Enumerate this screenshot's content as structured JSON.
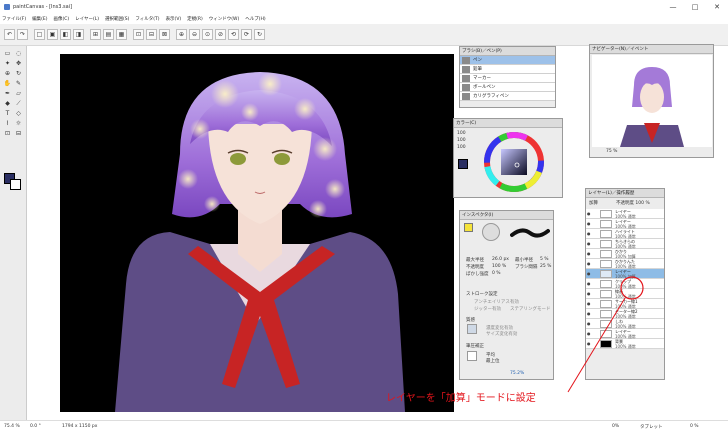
{
  "window": {
    "title": "paintCanvas - [Ins3.sai]",
    "controls": [
      "—",
      "□",
      "✕"
    ]
  },
  "menu": [
    "ファイル(F)",
    "編集(E)",
    "画像(C)",
    "レイヤー(L)",
    "選択範囲(S)",
    "フィルタ(T)",
    "表示(V)",
    "定規(R)",
    "ウィンドウ(W)",
    "ヘルプ(H)"
  ],
  "toolbar": {
    "buttons": [
      "↶",
      "↷",
      "□",
      "▣",
      "◧",
      "◨",
      "⊞",
      "▤",
      "▦",
      "⊡",
      "⊟",
      "⊠",
      "⊕",
      "⊖",
      "⊙",
      "⊘",
      "⟲",
      "⟳",
      "↻"
    ]
  },
  "brush_panel": {
    "tabs": "ブラシ(B)／ペン(P)",
    "items": [
      "ペン",
      "鉛筆",
      "マーカー",
      "ボールペン",
      "カリグラフィペン"
    ],
    "selected": 0
  },
  "color_panel": {
    "title": "カラー(C)",
    "values": [
      "100",
      "100",
      "100"
    ]
  },
  "inspector": {
    "title": "インスペクタ(I)",
    "brush_size_label": "最大半径",
    "brush_size": "26.0 px",
    "min_size_label": "最小半径",
    "min_size": "5 %",
    "density_label": "不透明度",
    "density": "100 %",
    "spacing_label": "ブラシ間隔",
    "spacing": "25 %",
    "blur_label": "ぼかし強度",
    "blur": "0 %",
    "stroke_title": "ストローク設定",
    "stroke_opt1": "アンチエイリアス有効",
    "stroke_opt2": "ジッター有効",
    "stroke_opt3": "ステアリングモード",
    "texture_title": "質感",
    "texture_opt1": "濃度変化有効",
    "texture_opt2": "サイズ変化有効",
    "pressure_title": "筆圧補正",
    "pressure_opt1": "平均",
    "pressure_opt2": "最上位",
    "zoom": "75.2%"
  },
  "navigator": {
    "title": "ナビゲーター(N)／イベント",
    "zoom": "75 %"
  },
  "layer_panel": {
    "title": "レイヤー(L)／操作履歴",
    "mode_label": "加算",
    "opacity_label": "不透明度 100 %",
    "layers": [
      {
        "name": "レイヤー",
        "mode": "100% 通常"
      },
      {
        "name": "レイヤー",
        "mode": "100% 通常"
      },
      {
        "name": "ハイライト",
        "mode": "100% 通常"
      },
      {
        "name": "ちらきらの",
        "mode": "100% 通常"
      },
      {
        "name": "ひかり",
        "mode": "100% 加算"
      },
      {
        "name": "ひかりんた",
        "mode": "100% 通常"
      },
      {
        "name": "レイヤー",
        "mode": "100% 加算"
      },
      {
        "name": "クリップ",
        "mode": "100% 通常"
      },
      {
        "name": "線画",
        "mode": "100% 通常"
      },
      {
        "name": "サーカー線1",
        "mode": "100% 通常"
      },
      {
        "name": "セーター線2",
        "mode": "100% 通常"
      },
      {
        "name": "しわ",
        "mode": "100% 通常"
      },
      {
        "name": "レイヤー",
        "mode": "100% 通常"
      },
      {
        "name": "背景",
        "mode": "100% 通常"
      }
    ],
    "selected": 6
  },
  "status": {
    "zoom": "75.4 %",
    "angle": "0.0 °",
    "size": "1794 x 1150 px",
    "right1": "0%",
    "right2": "タブレット",
    "right3": "0 %"
  },
  "annotation": {
    "text": "レイヤーを「加算」モードに設定"
  },
  "colors": {
    "canvas_bg": "#000000",
    "accent": "#e3141b",
    "selection": "#8ebce6",
    "uniform": "#5e4d86",
    "scarf": "#c72424",
    "hair": "#a47ad8"
  }
}
